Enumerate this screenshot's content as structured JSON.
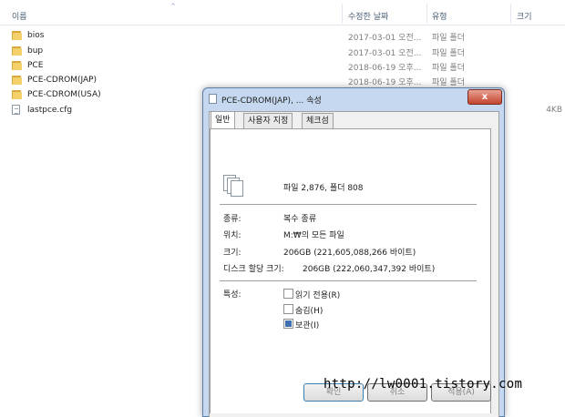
{
  "list": {
    "headers": {
      "name": "이름",
      "date": "수정한 날짜",
      "type": "유형",
      "size": "크기"
    },
    "rows": [
      {
        "name": "bios",
        "date": "2017-03-01 오전...",
        "type": "파일 폴더",
        "size": "",
        "icon": "folder-icon"
      },
      {
        "name": "bup",
        "date": "2017-03-01 오전...",
        "type": "파일 폴더",
        "size": "",
        "icon": "folder-icon"
      },
      {
        "name": "PCE",
        "date": "2018-06-19 오후...",
        "type": "파일 폴더",
        "size": "",
        "icon": "folder-icon"
      },
      {
        "name": "PCE-CDROM(JAP)",
        "date": "2018-06-19 오후...",
        "type": "파일 폴더",
        "size": "",
        "icon": "folder-icon"
      },
      {
        "name": "PCE-CDROM(USA)",
        "date": "",
        "type": "",
        "size": "",
        "icon": "folder-icon"
      },
      {
        "name": "lastpce.cfg",
        "date": "",
        "type": "",
        "size": "4KB",
        "icon": "file-icon"
      }
    ]
  },
  "dialog": {
    "title": "PCE-CDROM(JAP), ... 속성",
    "close": "x",
    "tabs": [
      "일반",
      "사용자 지정",
      "체크섬"
    ],
    "summary": "파일 2,876, 폴더 808",
    "fields": {
      "type_label": "종류:",
      "type_value": "복수 종류",
      "location_label": "위치:",
      "location_value": "M:₩의 모든 파일",
      "size_label": "크기:",
      "size_value": "206GB (221,605,088,266 바이트)",
      "disk_label": "디스크 할당 크기:",
      "disk_value": "206GB (222,060,347,392 바이트)"
    },
    "attributes": {
      "label": "특성:",
      "readonly": "읽기 전용(R)",
      "hidden": "숨김(H)",
      "archive": "보관(I)"
    },
    "buttons": {
      "ok": "확인",
      "cancel": "취소",
      "apply": "적용(A)"
    }
  },
  "watermark": "http://lw0001.tistory.com"
}
